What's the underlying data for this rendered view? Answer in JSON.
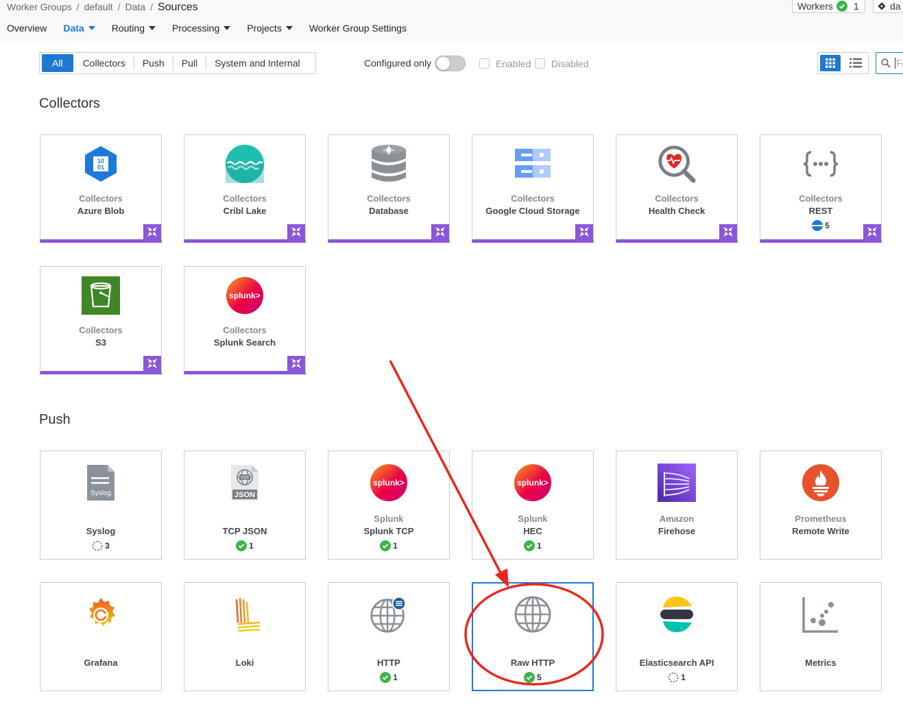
{
  "breadcrumb": {
    "items": [
      "Worker Groups",
      "default",
      "Data"
    ],
    "current": "Sources"
  },
  "workers": {
    "label": "Workers",
    "count": "1"
  },
  "branch": {
    "label": "da"
  },
  "nav": {
    "items": [
      "Overview",
      "Data",
      "Routing",
      "Processing",
      "Projects",
      "Worker Group Settings"
    ]
  },
  "filters": {
    "segments": [
      "All",
      "Collectors",
      "Push",
      "Pull",
      "System and Internal"
    ]
  },
  "configured_only": "Configured only",
  "checkbox_labels": {
    "enabled": "Enabled",
    "disabled": "Disabled"
  },
  "search": {
    "placeholder": "Fi"
  },
  "sections": {
    "collectors": "Collectors",
    "push": "Push"
  },
  "collectors": [
    {
      "cat": "Collectors",
      "name": "Azure Blob",
      "icon": "azure-blob-icon"
    },
    {
      "cat": "Collectors",
      "name": "Cribl Lake",
      "icon": "cribl-lake-icon"
    },
    {
      "cat": "Collectors",
      "name": "Database",
      "icon": "database-icon"
    },
    {
      "cat": "Collectors",
      "name": "Google Cloud Storage",
      "icon": "google-cloud-storage-icon"
    },
    {
      "cat": "Collectors",
      "name": "Health Check",
      "icon": "health-check-icon"
    },
    {
      "cat": "Collectors",
      "name": "REST",
      "icon": "rest-icon",
      "count": "5"
    },
    {
      "cat": "Collectors",
      "name": "S3",
      "icon": "s3-bucket-icon"
    },
    {
      "cat": "Collectors",
      "name": "Splunk Search",
      "icon": "splunk-icon"
    }
  ],
  "push": [
    {
      "cat": "",
      "name": "Syslog",
      "icon": "syslog-icon",
      "count": "3",
      "icon_text": "Syslog"
    },
    {
      "cat": "",
      "name": "TCP JSON",
      "icon": "tcp-json-icon",
      "count": "1",
      "icon_text": "JSON"
    },
    {
      "cat": "Splunk",
      "name": "Splunk TCP",
      "icon": "splunk-icon",
      "count": "1"
    },
    {
      "cat": "Splunk",
      "name": "HEC",
      "icon": "splunk-icon",
      "count": "1"
    },
    {
      "cat": "Amazon",
      "name": "Firehose",
      "icon": "amazon-firehose-icon"
    },
    {
      "cat": "Prometheus",
      "name": "Remote Write",
      "icon": "prometheus-icon"
    },
    {
      "cat": "",
      "name": "Grafana",
      "icon": "grafana-icon"
    },
    {
      "cat": "",
      "name": "Loki",
      "icon": "loki-icon"
    },
    {
      "cat": "",
      "name": "HTTP",
      "icon": "globe-icon",
      "count": "1"
    },
    {
      "cat": "",
      "name": "Raw HTTP",
      "icon": "globe-icon",
      "count": "5"
    },
    {
      "cat": "",
      "name": "Elasticsearch API",
      "icon": "elasticsearch-icon",
      "count": "1"
    },
    {
      "cat": "",
      "name": "Metrics",
      "icon": "metrics-icon"
    }
  ],
  "splunk_logo_text": "splunk>",
  "tcp_logo_text": "TCP",
  "azure_logo_text": [
    "10",
    "01"
  ],
  "colors": {
    "accent": "#1f78d1",
    "collector_bar": "#8b57d6",
    "ok": "#3cb44b",
    "annotation": "#e8281c"
  }
}
